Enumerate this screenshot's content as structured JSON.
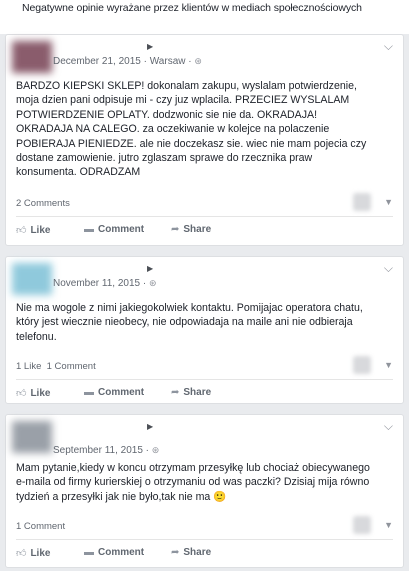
{
  "caption": "Negatywne opinie wyrażane przez klientów w mediach społecznościowych",
  "posts": [
    {
      "date": "December 21, 2015",
      "location": "Warsaw",
      "text": "BARDZO KIEPSKI SKLEP! dokonalam zakupu, wyslalam potwierdzenie,\nmoja dzien pani odpisuje mi - czy juz wplacila. PRZECIEZ WYSLALAM\nPOTWIERDZENIE OPLATY. dodzwonic sie nie da. OKRADAJA!\nOKRADAJA NA CALEGO. za oczekiwanie w kolejce na polaczenie\nPOBIERAJA PIENIEDZE. ale nie doczekasz sie. wiec nie mam pojecia czy\ndostane zamowienie. jutro zglaszam sprawe do rzecznika praw\nkonsumenta. ODRADZAM",
      "stats": "2 Comments",
      "avatar_color": "#8a5c6c"
    },
    {
      "date": "November 11, 2015",
      "location": "",
      "text": "Nie ma wogole z nimi jakiegokolwiek kontaktu. Pomijajac operatora chatu,\nktóry jest wiecznie nieobecy, nie odpowiadaja na maile ani nie odbieraja\ntelefonu.",
      "stats": "1 Like  1 Comment",
      "avatar_color": "#8fc9dc"
    },
    {
      "date": "September 11, 2015",
      "location": "",
      "text": "Mam pytanie,kiedy w koncu otrzymam przesyłkę lub chociaż obiecywanego\ne-maila od firmy kurierskiej o otrzymaniu od was paczki? Dzisiaj mija równo\ntydzień a przesyłki jak nie było,tak nie ma 🙂",
      "stats": "1 Comment",
      "avatar_color": "#9aa0a8"
    }
  ],
  "actions": {
    "like": "Like",
    "comment": "Comment",
    "share": "Share"
  },
  "icons": {
    "like": "thumbs-up-icon",
    "comment": "comment-icon",
    "share": "share-arrow-icon",
    "globe": "globe-icon",
    "options": "chevron-down-icon"
  }
}
